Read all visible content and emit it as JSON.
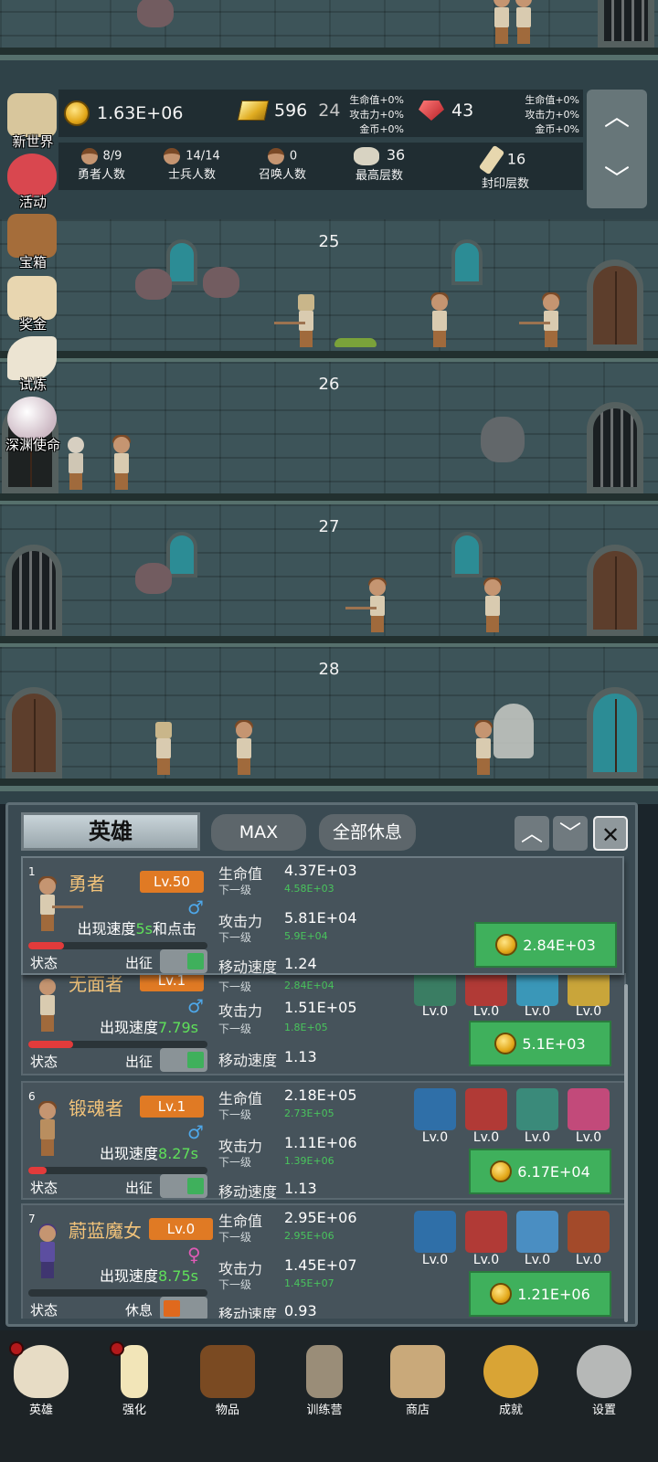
{
  "floors": [
    {
      "number": ""
    },
    {
      "number": "25"
    },
    {
      "number": "26"
    },
    {
      "number": "27"
    },
    {
      "number": "28"
    }
  ],
  "hud": {
    "coins": "1.63E+06",
    "gold": "596",
    "gold_level": "24",
    "gold_bonus": [
      "生命值+0%",
      "攻击力+0%",
      "金币+0%"
    ],
    "ruby": "43",
    "ruby_bonus": [
      "生命值+0%",
      "攻击力+0%",
      "金币+0%"
    ],
    "heroes_count": "8/9",
    "heroes_label": "勇者人数",
    "soldiers_count": "14/14",
    "soldiers_label": "士兵人数",
    "summon_count": "0",
    "summon_label": "召唤人数",
    "max_floor": "36",
    "max_floor_label": "最高层数",
    "sealed_floor": "16",
    "sealed_floor_label": "封印层数",
    "up_arrow": "︿",
    "down_arrow": "﹀"
  },
  "side_menu": [
    {
      "label": "新世界",
      "icon": "map-icon"
    },
    {
      "label": "活动",
      "icon": "heart-icon"
    },
    {
      "label": "宝箱",
      "icon": "chest-icon"
    },
    {
      "label": "奖金",
      "icon": "envelope-icon"
    },
    {
      "label": "试炼",
      "icon": "feather-icon"
    },
    {
      "label": "深渊使命",
      "icon": "pearl-icon"
    }
  ],
  "panel": {
    "title": "英雄",
    "max_label": "MAX",
    "rest_all_label": "全部休息",
    "up_label": "︿",
    "down_label": "﹀",
    "close_label": "✕"
  },
  "heroes": [
    {
      "index": "1",
      "name": "勇者",
      "level": "Lv.50",
      "gender": "♂",
      "speed_prefix": "出现速度",
      "speed": "5s",
      "speed_suffix": "和点击",
      "hp_label": "生命值",
      "hp": "4.37E+03",
      "hp_next_label": "下一级",
      "hp_next": "4.58E+03",
      "atk_label": "攻击力",
      "atk": "5.81E+04",
      "atk_next_label": "下一级",
      "atk_next": "5.9E+04",
      "move_label": "移动速度",
      "move": "1.24",
      "status_label": "状态",
      "state_label": "出征",
      "cost": "2.84E+03",
      "hp_fraction": 0.2
    },
    {
      "index": "",
      "name": "无面者",
      "level": "Lv.1",
      "gender": "♂",
      "speed_prefix": "出现速度",
      "speed": "7.79s",
      "speed_suffix": "",
      "hp_next_label": "下一级",
      "hp_next": "2.84E+04",
      "atk_label": "攻击力",
      "atk": "1.51E+05",
      "atk_next_label": "下一级",
      "atk_next": "1.8E+05",
      "move_label": "移动速度",
      "move": "1.13",
      "status_label": "状态",
      "state_label": "出征",
      "cost": "5.1E+03",
      "hp_fraction": 0.25,
      "equip_levels": [
        "Lv.0",
        "Lv.0",
        "Lv.0",
        "Lv.0"
      ]
    },
    {
      "index": "6",
      "name": "锻魂者",
      "level": "Lv.1",
      "gender": "♂",
      "speed_prefix": "出现速度",
      "speed": "8.27s",
      "speed_suffix": "",
      "hp_label": "生命值",
      "hp": "2.18E+05",
      "hp_next_label": "下一级",
      "hp_next": "2.73E+05",
      "atk_label": "攻击力",
      "atk": "1.11E+06",
      "atk_next_label": "下一级",
      "atk_next": "1.39E+06",
      "move_label": "移动速度",
      "move": "1.13",
      "status_label": "状态",
      "state_label": "出征",
      "cost": "6.17E+04",
      "hp_fraction": 0.1,
      "equip_levels": [
        "Lv.0",
        "Lv.0",
        "Lv.0",
        "Lv.0"
      ]
    },
    {
      "index": "7",
      "name": "蔚蓝魔女",
      "level": "Lv.0",
      "gender": "♀",
      "speed_prefix": "出现速度",
      "speed": "8.75s",
      "speed_suffix": "",
      "hp_label": "生命值",
      "hp": "2.95E+06",
      "hp_next_label": "下一级",
      "hp_next": "2.95E+06",
      "atk_label": "攻击力",
      "atk": "1.45E+07",
      "atk_next_label": "下一级",
      "atk_next": "1.45E+07",
      "move_label": "移动速度",
      "move": "0.93",
      "status_label": "状态",
      "state_label": "休息",
      "cost": "1.21E+06",
      "hp_fraction": 0,
      "equip_levels": [
        "Lv.0",
        "Lv.0",
        "Lv.0",
        "Lv.0"
      ]
    }
  ],
  "nav": [
    {
      "label": "英雄",
      "icon": "skull-icon",
      "badge": true
    },
    {
      "label": "强化",
      "icon": "candle-icon",
      "badge": true
    },
    {
      "label": "物品",
      "icon": "book-icon",
      "badge": false
    },
    {
      "label": "训练营",
      "icon": "lantern-icon",
      "badge": false
    },
    {
      "label": "商店",
      "icon": "beer-mug-icon",
      "badge": false
    },
    {
      "label": "成就",
      "icon": "key-icon",
      "badge": false
    },
    {
      "label": "设置",
      "icon": "gear-icon",
      "badge": false
    }
  ],
  "colors": {
    "accent_green": "#3fb05c",
    "level_orange": "#e07a24",
    "male_blue": "#4ea7e8",
    "female_pink": "#e05bb6",
    "knob_green": "#3fb05c",
    "knob_orange": "#e0691d"
  }
}
